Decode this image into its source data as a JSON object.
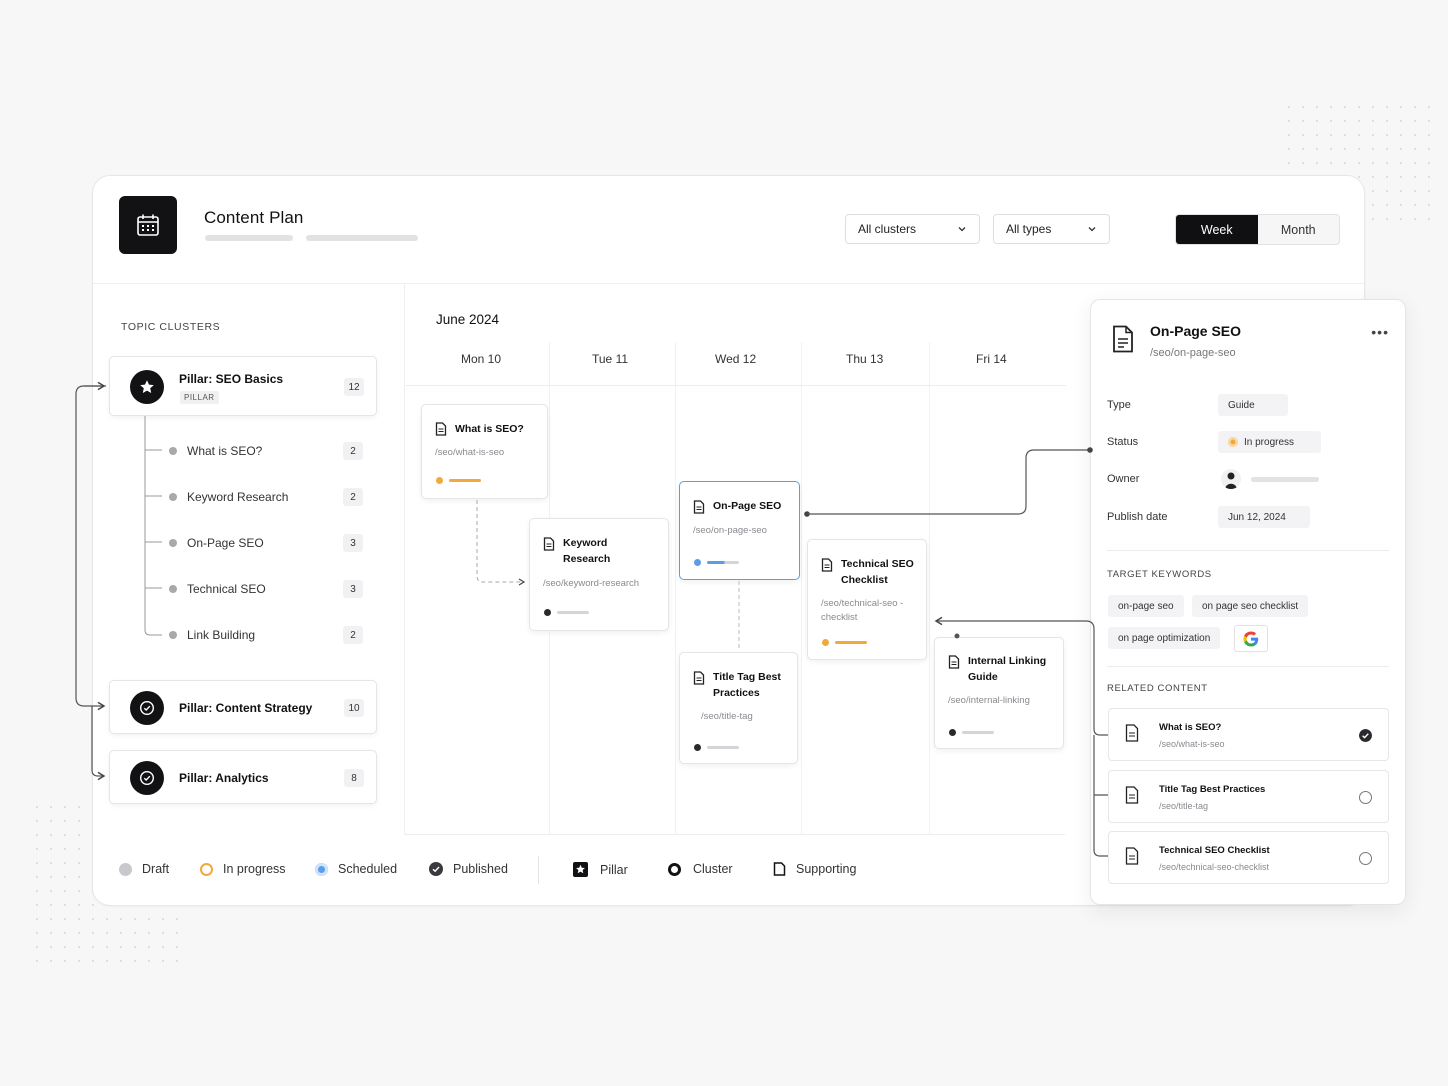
{
  "header": {
    "title": "Content Plan",
    "filter_clusters": "All clusters",
    "filter_types": "All types",
    "view_week": "Week",
    "view_month": "Month"
  },
  "sidebar": {
    "heading": "TOPIC CLUSTERS",
    "pillar1": {
      "title": "Pillar: SEO Basics",
      "tag": "PILLAR",
      "count": "12"
    },
    "children": [
      {
        "label": "What is SEO?",
        "count": "2"
      },
      {
        "label": "Keyword Research",
        "count": "2"
      },
      {
        "label": "On-Page SEO",
        "count": "3"
      },
      {
        "label": "Technical SEO",
        "count": "3"
      },
      {
        "label": "Link Building",
        "count": "2"
      }
    ],
    "pillar2": {
      "title": "Pillar: Content Strategy",
      "count": "10"
    },
    "pillar3": {
      "title": "Pillar: Analytics",
      "count": "8"
    }
  },
  "calendar": {
    "month": "June 2024",
    "days": [
      "Mon 10",
      "Tue 11",
      "Wed 12",
      "Thu 13",
      "Fri 14"
    ],
    "cards": {
      "what_is_seo": {
        "title": "What is SEO?",
        "path": "/seo/what-is-seo",
        "status": "in-progress"
      },
      "keyword_research": {
        "title": "Keyword Research",
        "path": "/seo/keyword-research",
        "status": "draft"
      },
      "on_page_seo": {
        "title": "On-Page SEO",
        "path": "/seo/on-page-seo",
        "status": "scheduled"
      },
      "technical_seo": {
        "title": "Technical SEO Checklist",
        "path": "/seo/technical-seo -checklist",
        "status": "in-progress"
      },
      "title_tag": {
        "title": "Title Tag Best Practices",
        "path": "/seo/title-tag",
        "status": "draft"
      },
      "internal_linking": {
        "title": "Internal Linking Guide",
        "path": "/seo/internal-linking",
        "status": "draft"
      }
    }
  },
  "legend": {
    "draft": "Draft",
    "in_progress": "In progress",
    "scheduled": "Scheduled",
    "published": "Published",
    "pillar": "Pillar",
    "cluster": "Cluster",
    "supporting": "Supporting"
  },
  "panel": {
    "title": "On-Page SEO",
    "path": "/seo/on-page-seo",
    "type_label": "Type",
    "type_value": "Guide",
    "status_label": "Status",
    "status_value": "In progress",
    "owner_label": "Owner",
    "publish_label": "Publish date",
    "publish_value": "Jun 12, 2024",
    "keywords_heading": "TARGET KEYWORDS",
    "keywords": [
      "on-page seo",
      "on page seo checklist",
      "on page optimization"
    ],
    "related_heading": "RELATED CONTENT",
    "related": [
      {
        "title": "What is SEO?",
        "path": "/seo/what-is-seo",
        "done": true
      },
      {
        "title": "Title Tag Best Practices",
        "path": "/seo/title-tag",
        "done": false
      },
      {
        "title": "Technical SEO Checklist",
        "path": "/seo/technical-seo-checklist",
        "done": false
      }
    ]
  },
  "colors": {
    "accent_dark": "#121214",
    "in_progress": "#f2a93b",
    "scheduled": "#5b9ee8",
    "draft": "#b8b8bd",
    "published": "#3a3a3e"
  }
}
